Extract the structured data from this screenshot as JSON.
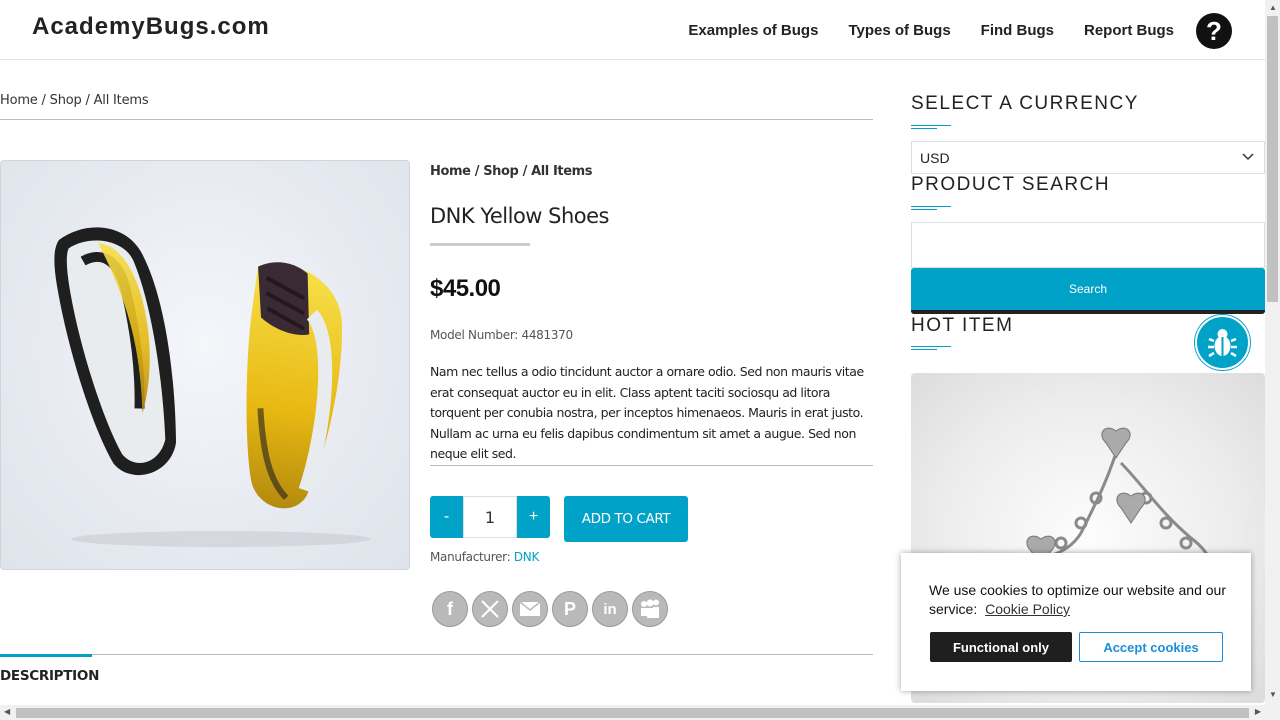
{
  "header": {
    "logo": "AcademyBugs.com",
    "nav": [
      "Examples of Bugs",
      "Types of Bugs",
      "Find Bugs",
      "Report Bugs"
    ],
    "help_glyph": "?"
  },
  "breadcrumb": {
    "home": "Home",
    "shop": "Shop",
    "current": "All Items",
    "sep": " / "
  },
  "product": {
    "title": "DNK Yellow Shoes",
    "price": "$45.00",
    "model": "Model Number: 4481370",
    "description": "Nam nec tellus a odio tincidunt auctor a ornare odio. Sed non mauris vitae erat consequat auctor eu in elit. Class aptent taciti sociosqu ad litora torquent per conubia nostra, per inceptos himenaeos. Mauris in erat justo. Nullam ac urna eu felis dapibus condimentum sit amet a augue. Sed non neque elit sed.",
    "qty_minus": "-",
    "qty_value": "1",
    "qty_plus": "+",
    "add_to_cart": "ADD TO CART",
    "manufacturer_label": "Manufacturer:",
    "manufacturer": "DNK",
    "share_icons": [
      "facebook-icon",
      "x-icon",
      "email-icon",
      "pinterest-icon",
      "linkedin-icon",
      "myspace-icon"
    ]
  },
  "tabs": {
    "description": "DESCRIPTION"
  },
  "sidebar": {
    "currency_heading": "SELECT A CURRENCY",
    "currency_value": "USD",
    "search_heading": "PRODUCT SEARCH",
    "search_button": "Search",
    "hot_heading": "HOT ITEM"
  },
  "cookie": {
    "text": "We use cookies to optimize our website and our service:",
    "link": "Cookie Policy",
    "functional": "Functional only",
    "accept": "Accept cookies"
  },
  "colors": {
    "accent": "#00a2c7",
    "dark": "#1f1f1f",
    "cookie_link_blue": "#1a8fd6"
  }
}
